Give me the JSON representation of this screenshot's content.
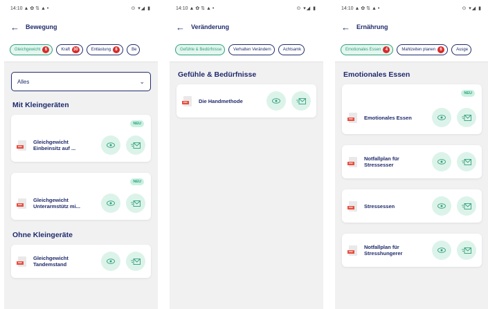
{
  "status": {
    "time": "14:10",
    "left_icons": "▲ ✿ ⇅ ▲ •",
    "right_icons": "⊙ ▾◢ ▮"
  },
  "screens": [
    {
      "title": "Bewegung",
      "chips": [
        {
          "label": "Gleichgewicht",
          "badge": "6",
          "active": true
        },
        {
          "label": "Kraft",
          "badge": "30",
          "active": false
        },
        {
          "label": "Entlastung",
          "badge": "8",
          "active": false
        },
        {
          "label": "Be",
          "badge": "",
          "active": false
        }
      ],
      "dropdown": "Alles",
      "sections": [
        {
          "title": "Mit Kleingeräten",
          "cards": [
            {
              "title": "Gleichgewicht Einbeinsitz auf ...",
              "neu": "NEU"
            },
            {
              "title": "Gleichgewicht Unterarmstütz mi...",
              "neu": "NEU"
            }
          ]
        },
        {
          "title": "Ohne Kleingeräte",
          "cards": [
            {
              "title": "Gleichgewicht Tandemstand",
              "neu": ""
            }
          ]
        }
      ]
    },
    {
      "title": "Veränderung",
      "chips": [
        {
          "label": "Gefühle & Bedürfnisse",
          "badge": "",
          "active": true
        },
        {
          "label": "Verhalten Verändern",
          "badge": "",
          "active": false
        },
        {
          "label": "Achtsamk",
          "badge": "",
          "active": false
        }
      ],
      "sections": [
        {
          "title": "Gefühle & Bedürfnisse",
          "cards": [
            {
              "title": "Die Handmethode",
              "neu": ""
            }
          ]
        }
      ]
    },
    {
      "title": "Ernährung",
      "chips": [
        {
          "label": "Emotionales Essen",
          "badge": "4",
          "active": true
        },
        {
          "label": "Mahlzeiten planen",
          "badge": "6",
          "active": false
        },
        {
          "label": "Ausge",
          "badge": "",
          "active": false
        }
      ],
      "sections": [
        {
          "title": "Emotionales Essen",
          "cards": [
            {
              "title": "Emotionales Essen",
              "neu": "NEU"
            },
            {
              "title": "Notfallplan für Stressesser",
              "neu": ""
            },
            {
              "title": "Stressessen",
              "neu": ""
            },
            {
              "title": "Notfallplan für Stresshungerer",
              "neu": ""
            }
          ]
        }
      ]
    }
  ],
  "icons": {
    "back": "arrow-left-icon",
    "view": "eye-icon",
    "send": "send-mail-icon",
    "file": "pdf-file-icon",
    "dropdown": "chevron-down-icon"
  },
  "colors": {
    "primary": "#1f2a6b",
    "accent": "#2e9f7c",
    "accent_bg": "#dcf3ea",
    "badge": "#d92b2b",
    "neu_bg": "#c9f1e2"
  }
}
